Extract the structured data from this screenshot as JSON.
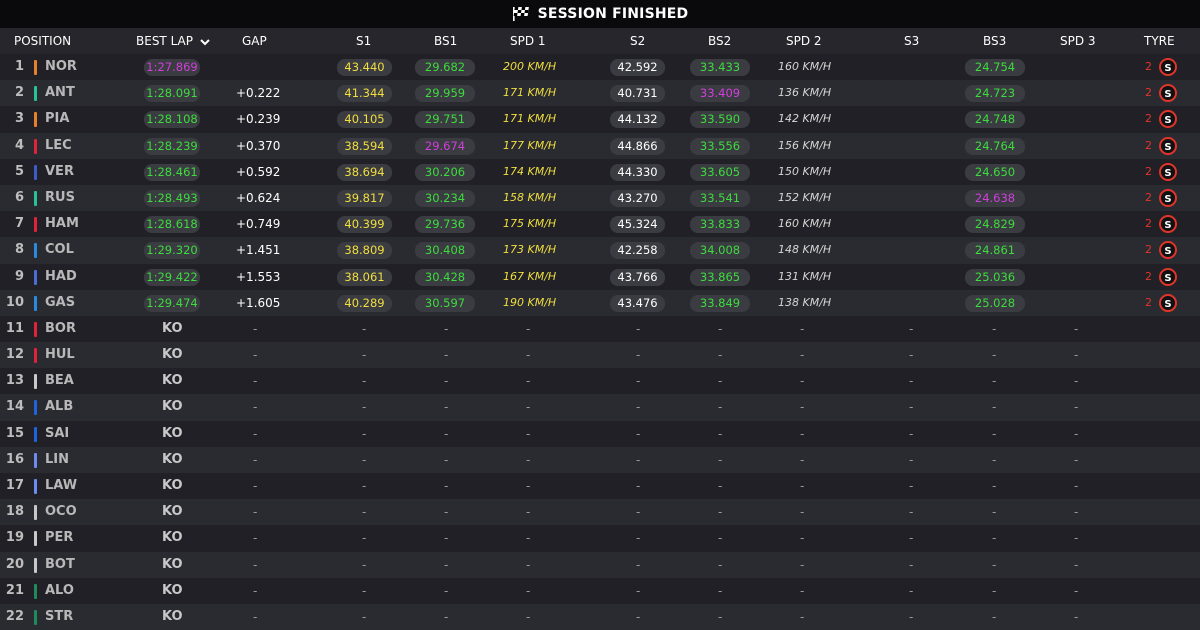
{
  "header": {
    "title": "SESSION FINISHED",
    "icon": "checkered-flag-icon"
  },
  "columns": {
    "position": "POSITION",
    "best_lap": "BEST LAP",
    "gap": "GAP",
    "s1": "S1",
    "bs1": "BS1",
    "spd1": "SPD 1",
    "s2": "S2",
    "bs2": "BS2",
    "spd2": "SPD 2",
    "s3": "S3",
    "bs3": "BS3",
    "spd3": "SPD 3",
    "tyre": "TYRE"
  },
  "colors": {
    "yellow": "#f0df3e",
    "green": "#3ddc3d",
    "purple": "#d23fdc",
    "tyre_soft": "#e0352a"
  },
  "rows": [
    {
      "pos": "1",
      "driver": "NOR",
      "team_color": "#e8802a",
      "best_lap": "1:27.869",
      "best_lap_color": "purple",
      "gap": "",
      "s1": "43.440",
      "s1_color": "yellow",
      "bs1": "29.682",
      "bs1_color": "green",
      "spd1": "200 KM/H",
      "s2": "42.592",
      "s2_color": "white",
      "bs2": "33.433",
      "bs2_color": "green",
      "spd2": "160 KM/H",
      "s3": "",
      "bs3": "24.754",
      "bs3_color": "green",
      "spd3": "",
      "tyre_count": "2",
      "tyre": "S"
    },
    {
      "pos": "2",
      "driver": "ANT",
      "team_color": "#27c29a",
      "best_lap": "1:28.091",
      "best_lap_color": "green",
      "gap": "+0.222",
      "s1": "41.344",
      "s1_color": "yellow",
      "bs1": "29.959",
      "bs1_color": "green",
      "spd1": "171 KM/H",
      "s2": "40.731",
      "s2_color": "white",
      "bs2": "33.409",
      "bs2_color": "purple",
      "spd2": "136 KM/H",
      "s3": "",
      "bs3": "24.723",
      "bs3_color": "green",
      "spd3": "",
      "tyre_count": "2",
      "tyre": "S"
    },
    {
      "pos": "3",
      "driver": "PIA",
      "team_color": "#e8802a",
      "best_lap": "1:28.108",
      "best_lap_color": "green",
      "gap": "+0.239",
      "s1": "40.105",
      "s1_color": "yellow",
      "bs1": "29.751",
      "bs1_color": "green",
      "spd1": "171 KM/H",
      "s2": "44.132",
      "s2_color": "white",
      "bs2": "33.590",
      "bs2_color": "green",
      "spd2": "142 KM/H",
      "s3": "",
      "bs3": "24.748",
      "bs3_color": "green",
      "spd3": "",
      "tyre_count": "2",
      "tyre": "S"
    },
    {
      "pos": "4",
      "driver": "LEC",
      "team_color": "#e0233a",
      "best_lap": "1:28.239",
      "best_lap_color": "green",
      "gap": "+0.370",
      "s1": "38.594",
      "s1_color": "yellow",
      "bs1": "29.674",
      "bs1_color": "purple",
      "spd1": "177 KM/H",
      "s2": "44.866",
      "s2_color": "white",
      "bs2": "33.556",
      "bs2_color": "green",
      "spd2": "156 KM/H",
      "s3": "",
      "bs3": "24.764",
      "bs3_color": "green",
      "spd3": "",
      "tyre_count": "2",
      "tyre": "S"
    },
    {
      "pos": "5",
      "driver": "VER",
      "team_color": "#3a5dc9",
      "best_lap": "1:28.461",
      "best_lap_color": "green",
      "gap": "+0.592",
      "s1": "38.694",
      "s1_color": "yellow",
      "bs1": "30.206",
      "bs1_color": "green",
      "spd1": "174 KM/H",
      "s2": "44.330",
      "s2_color": "white",
      "bs2": "33.605",
      "bs2_color": "green",
      "spd2": "150 KM/H",
      "s3": "",
      "bs3": "24.650",
      "bs3_color": "green",
      "spd3": "",
      "tyre_count": "2",
      "tyre": "S"
    },
    {
      "pos": "6",
      "driver": "RUS",
      "team_color": "#27c29a",
      "best_lap": "1:28.493",
      "best_lap_color": "green",
      "gap": "+0.624",
      "s1": "39.817",
      "s1_color": "yellow",
      "bs1": "30.234",
      "bs1_color": "green",
      "spd1": "158 KM/H",
      "s2": "43.270",
      "s2_color": "white",
      "bs2": "33.541",
      "bs2_color": "green",
      "spd2": "152 KM/H",
      "s3": "",
      "bs3": "24.638",
      "bs3_color": "purple",
      "spd3": "",
      "tyre_count": "2",
      "tyre": "S"
    },
    {
      "pos": "7",
      "driver": "HAM",
      "team_color": "#e0233a",
      "best_lap": "1:28.618",
      "best_lap_color": "green",
      "gap": "+0.749",
      "s1": "40.399",
      "s1_color": "yellow",
      "bs1": "29.736",
      "bs1_color": "green",
      "spd1": "175 KM/H",
      "s2": "45.324",
      "s2_color": "white",
      "bs2": "33.833",
      "bs2_color": "green",
      "spd2": "160 KM/H",
      "s3": "",
      "bs3": "24.829",
      "bs3_color": "green",
      "spd3": "",
      "tyre_count": "2",
      "tyre": "S"
    },
    {
      "pos": "8",
      "driver": "COL",
      "team_color": "#2b8ae0",
      "best_lap": "1:29.320",
      "best_lap_color": "green",
      "gap": "+1.451",
      "s1": "38.809",
      "s1_color": "yellow",
      "bs1": "30.408",
      "bs1_color": "green",
      "spd1": "173 KM/H",
      "s2": "42.258",
      "s2_color": "white",
      "bs2": "34.008",
      "bs2_color": "green",
      "spd2": "148 KM/H",
      "s3": "",
      "bs3": "24.861",
      "bs3_color": "green",
      "spd3": "",
      "tyre_count": "2",
      "tyre": "S"
    },
    {
      "pos": "9",
      "driver": "HAD",
      "team_color": "#4a6cd6",
      "best_lap": "1:29.422",
      "best_lap_color": "green",
      "gap": "+1.553",
      "s1": "38.061",
      "s1_color": "yellow",
      "bs1": "30.428",
      "bs1_color": "green",
      "spd1": "167 KM/H",
      "s2": "43.766",
      "s2_color": "white",
      "bs2": "33.865",
      "bs2_color": "green",
      "spd2": "131 KM/H",
      "s3": "",
      "bs3": "25.036",
      "bs3_color": "green",
      "spd3": "",
      "tyre_count": "2",
      "tyre": "S"
    },
    {
      "pos": "10",
      "driver": "GAS",
      "team_color": "#2b8ae0",
      "best_lap": "1:29.474",
      "best_lap_color": "green",
      "gap": "+1.605",
      "s1": "40.289",
      "s1_color": "yellow",
      "bs1": "30.597",
      "bs1_color": "green",
      "spd1": "190 KM/H",
      "s2": "43.476",
      "s2_color": "white",
      "bs2": "33.849",
      "bs2_color": "green",
      "spd2": "138 KM/H",
      "s3": "",
      "bs3": "25.028",
      "bs3_color": "green",
      "spd3": "",
      "tyre_count": "2",
      "tyre": "S"
    },
    {
      "pos": "11",
      "driver": "BOR",
      "team_color": "#e0233a",
      "best_lap": "KO",
      "gap": "-",
      "s1": "-",
      "bs1": "-",
      "spd1": "-",
      "s2": "-",
      "bs2": "-",
      "spd2": "-",
      "s3": "-",
      "bs3": "-",
      "spd3": "-"
    },
    {
      "pos": "12",
      "driver": "HUL",
      "team_color": "#e0233a",
      "best_lap": "KO",
      "gap": "-",
      "s1": "-",
      "bs1": "-",
      "spd1": "-",
      "s2": "-",
      "bs2": "-",
      "spd2": "-",
      "s3": "-",
      "bs3": "-",
      "spd3": "-"
    },
    {
      "pos": "13",
      "driver": "BEA",
      "team_color": "#c8c8c8",
      "best_lap": "KO",
      "gap": "-",
      "s1": "-",
      "bs1": "-",
      "spd1": "-",
      "s2": "-",
      "bs2": "-",
      "spd2": "-",
      "s3": "-",
      "bs3": "-",
      "spd3": "-"
    },
    {
      "pos": "14",
      "driver": "ALB",
      "team_color": "#1e64e0",
      "best_lap": "KO",
      "gap": "-",
      "s1": "-",
      "bs1": "-",
      "spd1": "-",
      "s2": "-",
      "bs2": "-",
      "spd2": "-",
      "s3": "-",
      "bs3": "-",
      "spd3": "-"
    },
    {
      "pos": "15",
      "driver": "SAI",
      "team_color": "#1e64e0",
      "best_lap": "KO",
      "gap": "-",
      "s1": "-",
      "bs1": "-",
      "spd1": "-",
      "s2": "-",
      "bs2": "-",
      "spd2": "-",
      "s3": "-",
      "bs3": "-",
      "spd3": "-"
    },
    {
      "pos": "16",
      "driver": "LIN",
      "team_color": "#6b8cf0",
      "best_lap": "KO",
      "gap": "-",
      "s1": "-",
      "bs1": "-",
      "spd1": "-",
      "s2": "-",
      "bs2": "-",
      "spd2": "-",
      "s3": "-",
      "bs3": "-",
      "spd3": "-"
    },
    {
      "pos": "17",
      "driver": "LAW",
      "team_color": "#6b8cf0",
      "best_lap": "KO",
      "gap": "-",
      "s1": "-",
      "bs1": "-",
      "spd1": "-",
      "s2": "-",
      "bs2": "-",
      "spd2": "-",
      "s3": "-",
      "bs3": "-",
      "spd3": "-"
    },
    {
      "pos": "18",
      "driver": "OCO",
      "team_color": "#c8c8c8",
      "best_lap": "KO",
      "gap": "-",
      "s1": "-",
      "bs1": "-",
      "spd1": "-",
      "s2": "-",
      "bs2": "-",
      "spd2": "-",
      "s3": "-",
      "bs3": "-",
      "spd3": "-"
    },
    {
      "pos": "19",
      "driver": "PER",
      "team_color": "#c8c8c8",
      "best_lap": "KO",
      "gap": "-",
      "s1": "-",
      "bs1": "-",
      "spd1": "-",
      "s2": "-",
      "bs2": "-",
      "spd2": "-",
      "s3": "-",
      "bs3": "-",
      "spd3": "-"
    },
    {
      "pos": "20",
      "driver": "BOT",
      "team_color": "#c8c8c8",
      "best_lap": "KO",
      "gap": "-",
      "s1": "-",
      "bs1": "-",
      "spd1": "-",
      "s2": "-",
      "bs2": "-",
      "spd2": "-",
      "s3": "-",
      "bs3": "-",
      "spd3": "-"
    },
    {
      "pos": "21",
      "driver": "ALO",
      "team_color": "#1f8a5a",
      "best_lap": "KO",
      "gap": "-",
      "s1": "-",
      "bs1": "-",
      "spd1": "-",
      "s2": "-",
      "bs2": "-",
      "spd2": "-",
      "s3": "-",
      "bs3": "-",
      "spd3": "-"
    },
    {
      "pos": "22",
      "driver": "STR",
      "team_color": "#1f8a5a",
      "best_lap": "KO",
      "gap": "-",
      "s1": "-",
      "bs1": "-",
      "spd1": "-",
      "s2": "-",
      "bs2": "-",
      "spd2": "-",
      "s3": "-",
      "bs3": "-",
      "spd3": "-"
    }
  ]
}
